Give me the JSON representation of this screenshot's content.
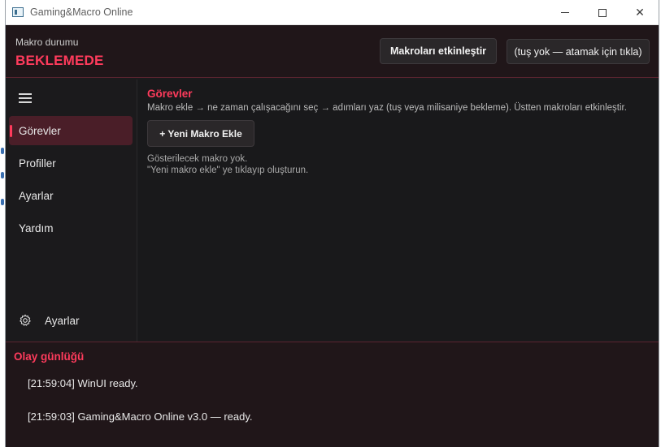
{
  "window": {
    "title": "Gaming&Macro Online"
  },
  "header": {
    "status_label": "Makro durumu",
    "status_value": "BEKLEMEDE",
    "enable_button": "Makroları etkinleştir",
    "key_button": "(tuş yok — atamak için tıkla)"
  },
  "sidebar": {
    "items": [
      {
        "label": "Görevler",
        "active": true
      },
      {
        "label": "Profiller",
        "active": false
      },
      {
        "label": "Ayarlar",
        "active": false
      },
      {
        "label": "Yardım",
        "active": false
      }
    ],
    "settings_label": "Ayarlar"
  },
  "main": {
    "title": "Görevler",
    "description": "Makro ekle → ne zaman çalışacağını seç → adımları yaz (tuş veya milisaniye bekleme). Üstten makroları etkinleştir.",
    "add_button": "+ Yeni Makro Ekle",
    "empty_line1": "Gösterilecek makro yok.",
    "empty_line2": "\"Yeni makro ekle\" ye tıklayıp oluşturun."
  },
  "log": {
    "title": "Olay günlüğü",
    "entries": [
      "[21:59:04] WinUI ready.",
      "[21:59:03] Gaming&Macro Online v3.0 — ready."
    ]
  },
  "colors": {
    "accent": "#ff3b5c",
    "background": "#1b1a1c",
    "header_bg": "#201619",
    "nav_active_bg": "#4a1e28"
  },
  "icons": {
    "app": "app-window-icon",
    "menu": "hamburger-icon",
    "settings": "gear-icon"
  }
}
